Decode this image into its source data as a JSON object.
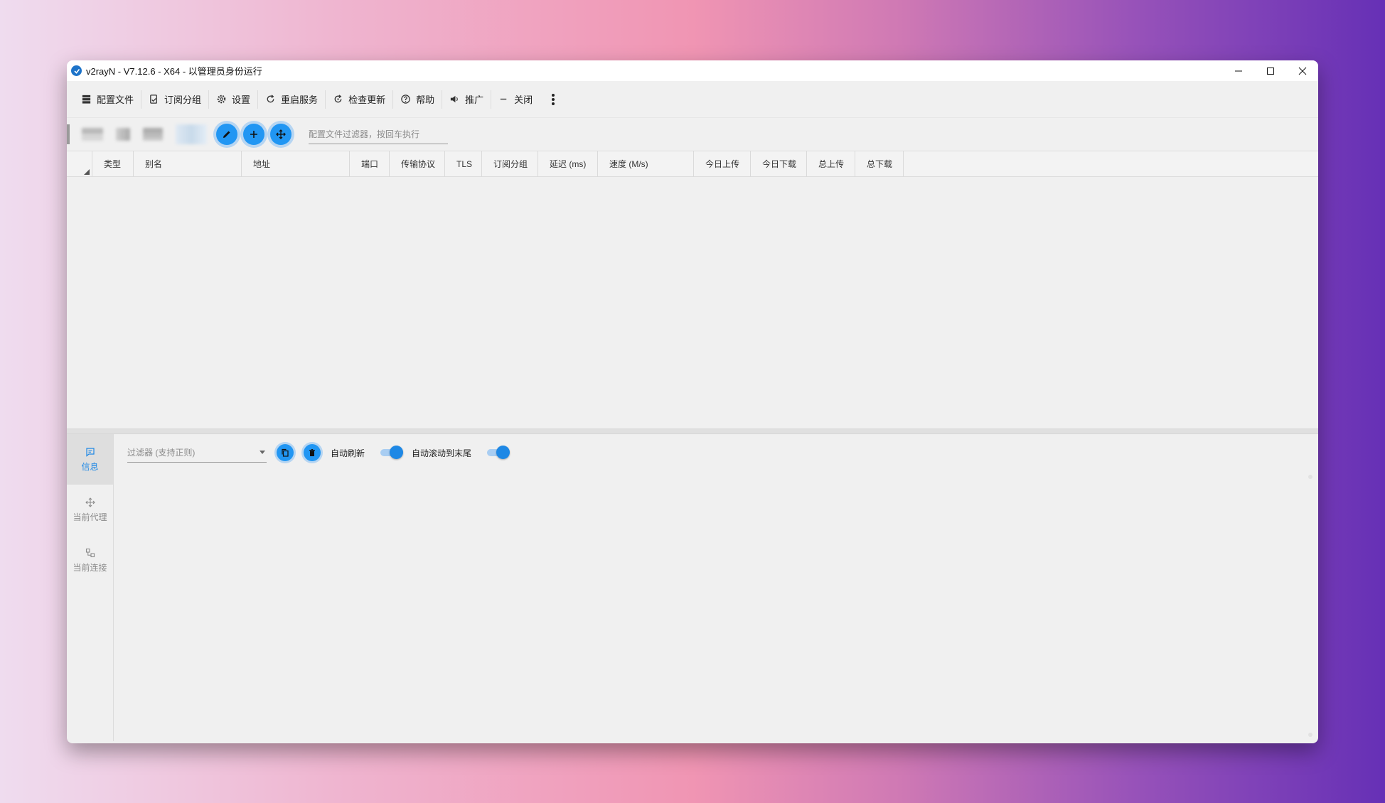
{
  "window": {
    "title": "v2rayN - V7.12.6 - X64 - 以管理员身份运行"
  },
  "menu": {
    "items": [
      {
        "label": "配置文件",
        "icon": "server-icon"
      },
      {
        "label": "订阅分组",
        "icon": "subscription-icon"
      },
      {
        "label": "设置",
        "icon": "gear-icon"
      },
      {
        "label": "重启服务",
        "icon": "restart-icon"
      },
      {
        "label": "检查更新",
        "icon": "update-icon"
      },
      {
        "label": "帮助",
        "icon": "help-icon"
      },
      {
        "label": "推广",
        "icon": "speaker-icon"
      },
      {
        "label": "关闭",
        "icon": "minus-icon"
      }
    ]
  },
  "toolbar": {
    "filter_placeholder": "配置文件过滤器，按回车执行"
  },
  "table": {
    "columns": [
      "类型",
      "别名",
      "地址",
      "端口",
      "传输协议",
      "TLS",
      "订阅分组",
      "延迟 (ms)",
      "速度 (M/s)",
      "今日上传",
      "今日下载",
      "总上传",
      "总下载"
    ],
    "rows": []
  },
  "side_tabs": [
    {
      "label": "信息",
      "active": true
    },
    {
      "label": "当前代理",
      "active": false
    },
    {
      "label": "当前连接",
      "active": false
    }
  ],
  "log": {
    "filter_placeholder": "过滤器 (支持正则)",
    "auto_refresh_label": "自动刷新",
    "auto_refresh_on": true,
    "auto_scroll_label": "自动滚动到末尾",
    "auto_scroll_on": true
  },
  "colors": {
    "accent": "#2196f3",
    "window_bg": "#f0f0f0"
  }
}
